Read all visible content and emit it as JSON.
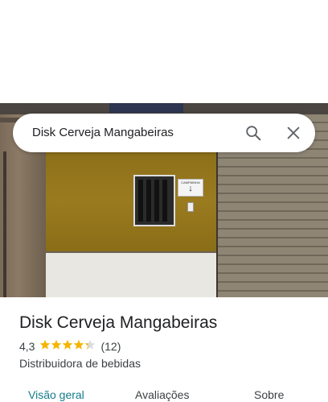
{
  "search": {
    "query": "Disk Cerveja Mangabeiras",
    "search_icon": "search-icon",
    "close_icon": "close-icon"
  },
  "photo": {
    "bell_sign_text": "CAMPAINHA",
    "bell_sign_arrow": "↓"
  },
  "place": {
    "name": "Disk Cerveja Mangabeiras",
    "rating": "4,3",
    "rating_value": 4.3,
    "stars": "★★★★★",
    "review_count": "(12)",
    "category": "Distribuidora de bebidas"
  },
  "tabs": [
    {
      "label": "Visão geral",
      "active": true
    },
    {
      "label": "Avaliações",
      "active": false
    },
    {
      "label": "Sobre",
      "active": false
    }
  ],
  "colors": {
    "accent": "#137b8c",
    "star": "#f4b400"
  }
}
